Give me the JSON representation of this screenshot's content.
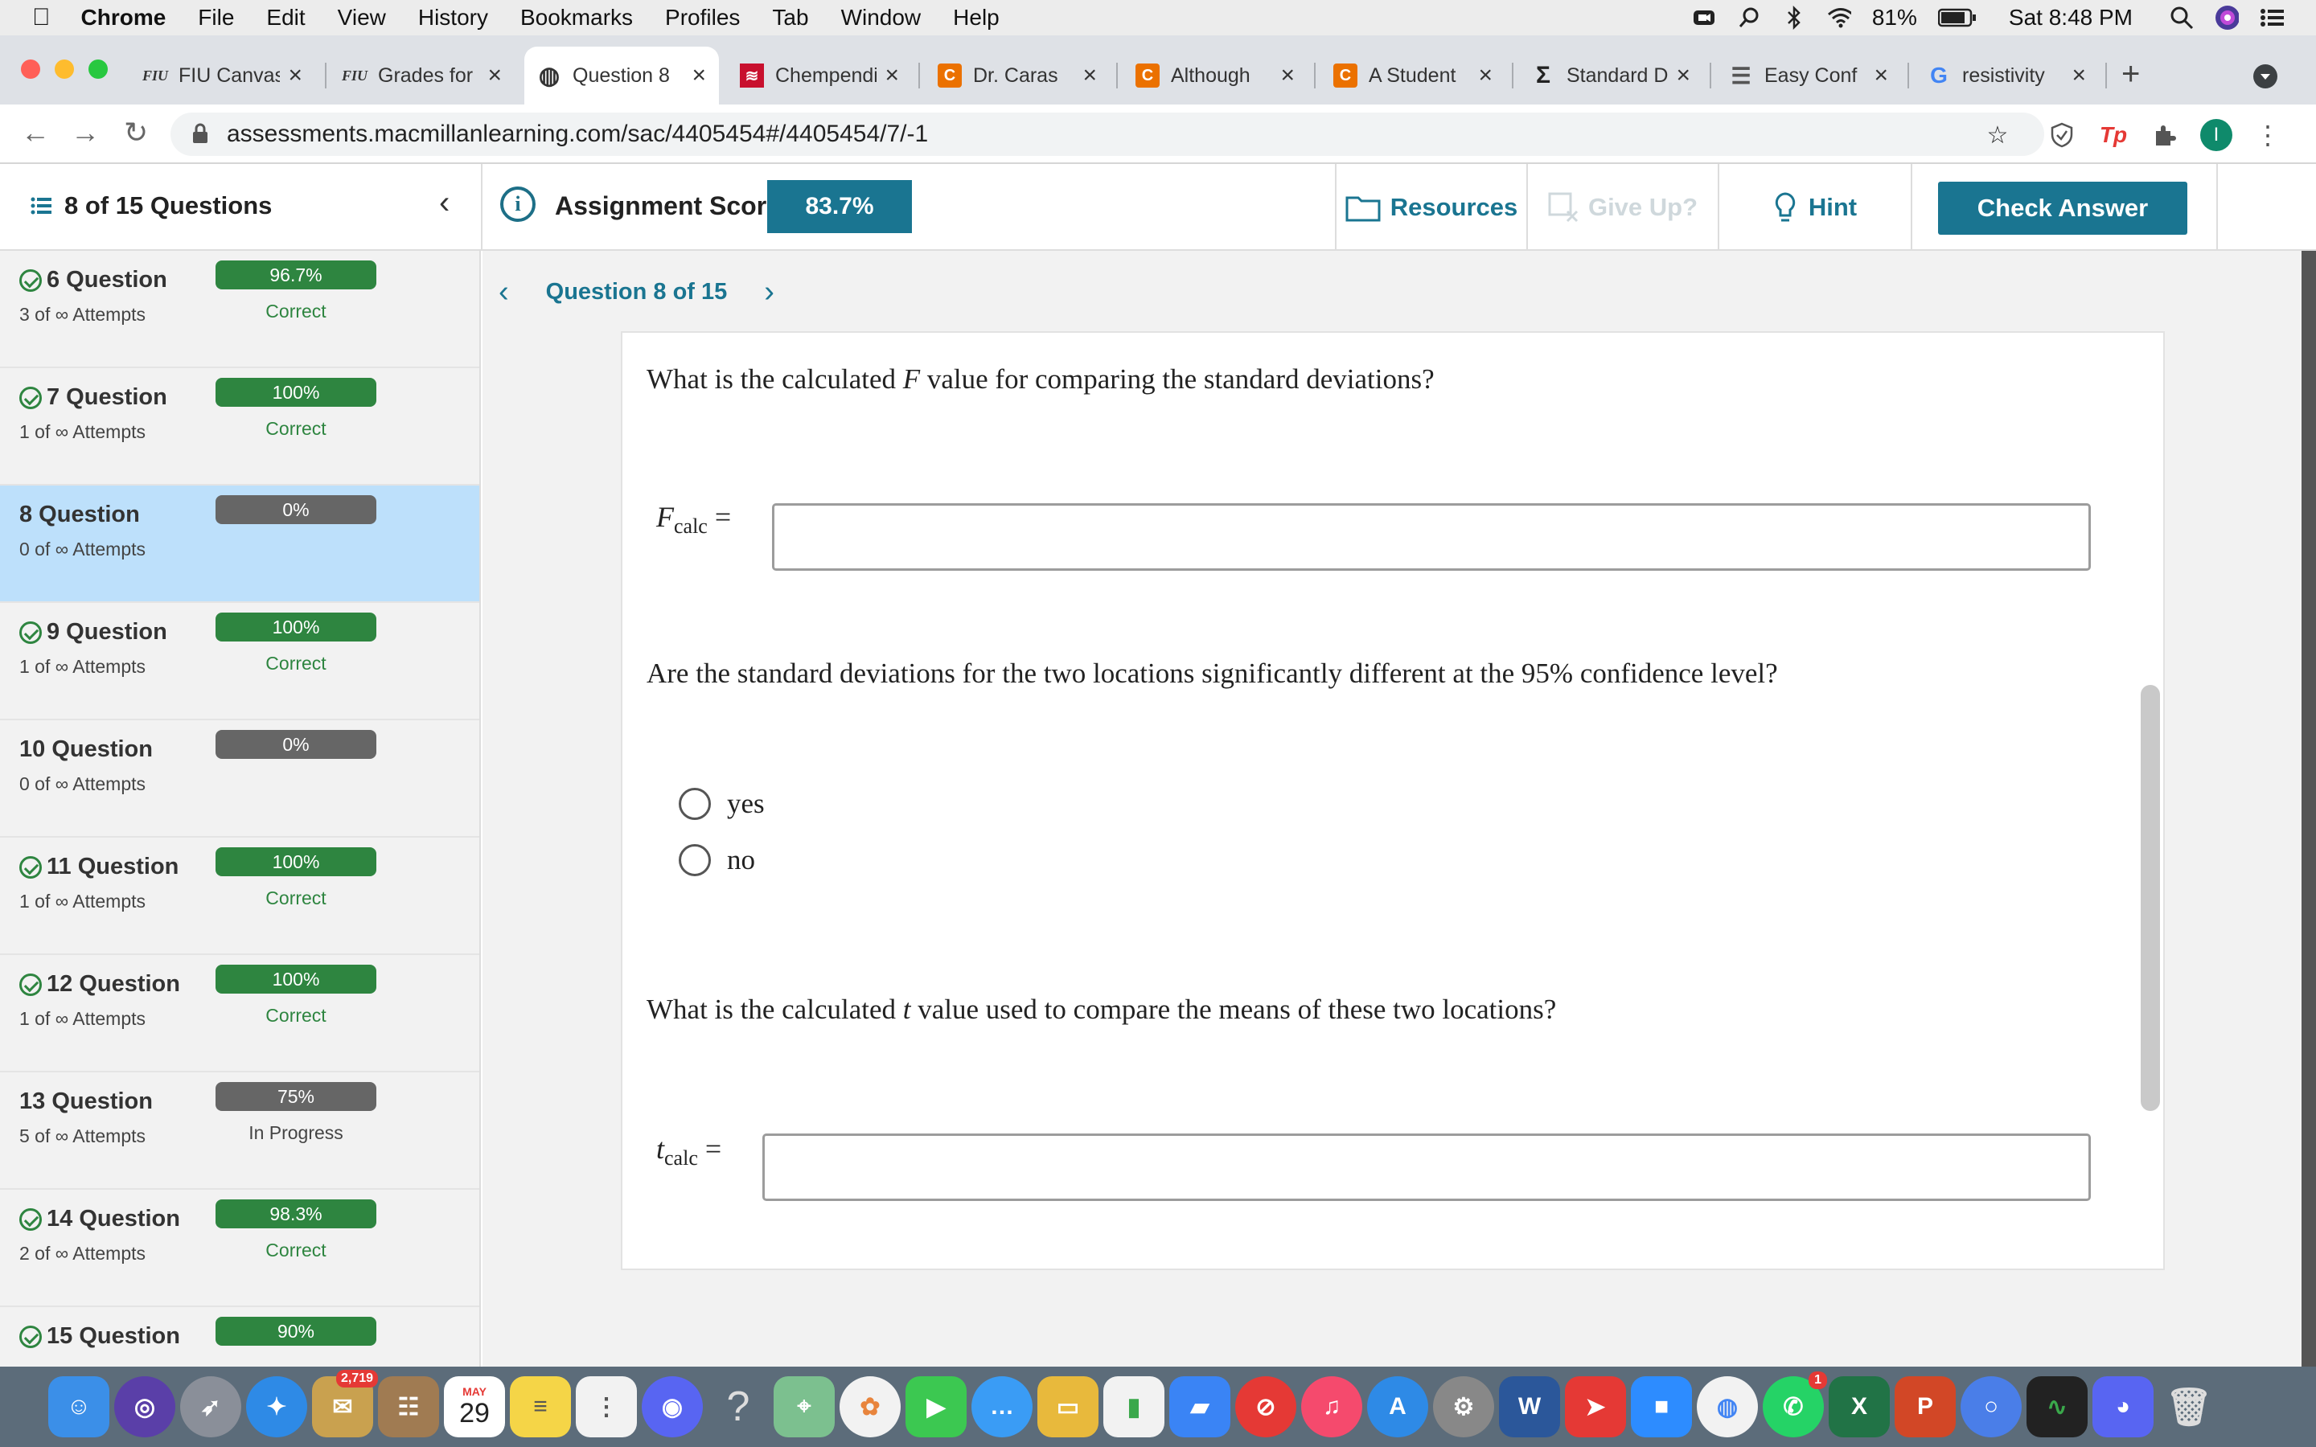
{
  "menubar": {
    "items": [
      {
        "label": "Chrome",
        "bold": true
      },
      {
        "label": "File"
      },
      {
        "label": "Edit"
      },
      {
        "label": "View"
      },
      {
        "label": "History"
      },
      {
        "label": "Bookmarks"
      },
      {
        "label": "Profiles"
      },
      {
        "label": "Tab"
      },
      {
        "label": "Window"
      },
      {
        "label": "Help"
      }
    ],
    "battery": "81%",
    "clock": "Sat 8:48 PM"
  },
  "tabs": [
    {
      "label": "FIU Canvas",
      "icon": "FIU",
      "icon_name": "fiu-logo-icon",
      "active": false
    },
    {
      "label": "Grades for",
      "icon": "FIU",
      "icon_name": "fiu-logo-icon",
      "active": false
    },
    {
      "label": "Question 8",
      "icon": "◍",
      "icon_name": "globe-icon",
      "active": true
    },
    {
      "label": "Chempendix",
      "icon": "≋",
      "icon_name": "macmillan-icon",
      "active": false
    },
    {
      "label": "Dr. Caras",
      "icon": "C",
      "icon_name": "chegg-icon",
      "active": false
    },
    {
      "label": "Although",
      "icon": "C",
      "icon_name": "chegg-icon",
      "active": false
    },
    {
      "label": "A Student",
      "icon": "C",
      "icon_name": "chegg-icon",
      "active": false
    },
    {
      "label": "Standard D",
      "icon": "Σ",
      "icon_name": "sigma-icon",
      "active": false
    },
    {
      "label": "Easy Conf",
      "icon": "☰",
      "icon_name": "document-icon",
      "active": false
    },
    {
      "label": "resistivity",
      "icon": "G",
      "icon_name": "google-icon",
      "active": false
    }
  ],
  "address": {
    "url": "assessments.macmillanlearning.com/sac/4405454#/4405454/7/-1"
  },
  "header": {
    "question_count": "8 of 15 Questions",
    "score_label": "Assignment Score:",
    "score_value": "83.7%",
    "resources": "Resources",
    "give_up": "Give Up?",
    "hint": "Hint",
    "check_answer": "Check Answer"
  },
  "sidebar": {
    "questions": [
      {
        "title": "6 Question",
        "attempts": "3 of ∞ Attempts",
        "score": "96.7%",
        "status": "Correct",
        "correct": true
      },
      {
        "title": "7 Question",
        "attempts": "1 of ∞ Attempts",
        "score": "100%",
        "status": "Correct",
        "correct": true
      },
      {
        "title": "8 Question",
        "attempts": "0 of ∞ Attempts",
        "score": "0%",
        "status": "",
        "correct": false,
        "active": true
      },
      {
        "title": "9 Question",
        "attempts": "1 of ∞ Attempts",
        "score": "100%",
        "status": "Correct",
        "correct": true
      },
      {
        "title": "10 Question",
        "attempts": "0 of ∞ Attempts",
        "score": "0%",
        "status": "",
        "correct": false
      },
      {
        "title": "11 Question",
        "attempts": "1 of ∞ Attempts",
        "score": "100%",
        "status": "Correct",
        "correct": true
      },
      {
        "title": "12 Question",
        "attempts": "1 of ∞ Attempts",
        "score": "100%",
        "status": "Correct",
        "correct": true
      },
      {
        "title": "13 Question",
        "attempts": "5 of ∞ Attempts",
        "score": "75%",
        "status": "In Progress",
        "correct": false
      },
      {
        "title": "14 Question",
        "attempts": "2 of ∞ Attempts",
        "score": "98.3%",
        "status": "Correct",
        "correct": true
      },
      {
        "title": "15 Question",
        "attempts": "",
        "score": "90%",
        "status": "",
        "correct": true
      }
    ]
  },
  "main": {
    "nav_label": "Question 8 of 15",
    "q1_prefix": "What is the calculated ",
    "q1_var": "F",
    "q1_suffix": " value for comparing the standard deviations?",
    "f_label_var": "F",
    "f_label_sub": "calc",
    "f_label_eq": " =",
    "f_value": "",
    "q2_text": "Are the standard deviations for the two locations significantly different at the 95% confidence level?",
    "option_yes": "yes",
    "option_no": "no",
    "q3_prefix": "What is the calculated ",
    "q3_var": "t",
    "q3_suffix": " value used to compare the means of these two locations?",
    "t_label_var": "t",
    "t_label_sub": "calc",
    "t_label_eq": " =",
    "t_value": ""
  },
  "dock": {
    "calendar_month": "MAY",
    "calendar_day": "29",
    "badge_photos": "2,719",
    "badge_whatsapp": "1"
  },
  "colors": {
    "accent": "#1a7591",
    "correct_green": "#2e8540",
    "active_row": "#bde0fb"
  }
}
